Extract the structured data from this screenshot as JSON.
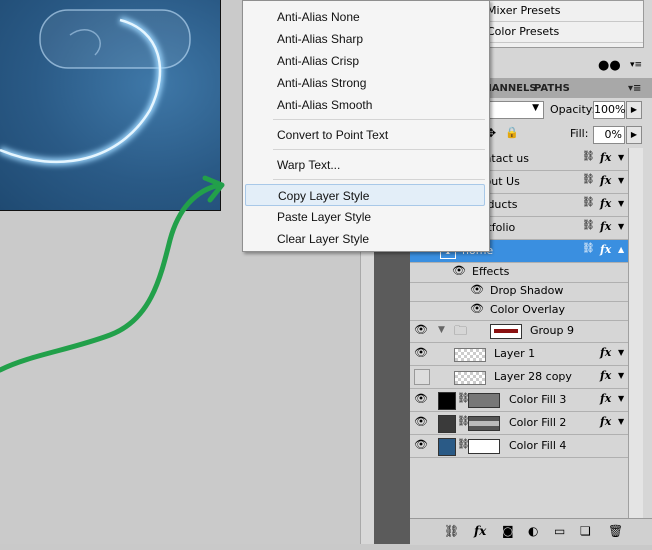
{
  "top_list": {
    "items": [
      "Mixer Presets",
      "Color Presets"
    ]
  },
  "layers_panel": {
    "tabs": [
      "CHANNELS",
      "PATHS"
    ],
    "opacity_label": "Opacity:",
    "opacity_value": "100%",
    "fill_label": "Fill:",
    "fill_value": "0%",
    "layers": [
      {
        "name": "Contact us",
        "fx": "fx"
      },
      {
        "name": "About Us",
        "fx": "fx"
      },
      {
        "name": "Products",
        "fx": "fx"
      },
      {
        "name": "Portfolio",
        "fx": "fx"
      },
      {
        "name": "home",
        "fx": "fx",
        "selected": true
      },
      {
        "name": "Effects"
      },
      {
        "name": "Drop Shadow"
      },
      {
        "name": "Color Overlay"
      },
      {
        "name": "Group 9"
      },
      {
        "name": "Layer 1",
        "fx": "fx"
      },
      {
        "name": "Layer 28 copy",
        "fx": "fx"
      },
      {
        "name": "Color Fill 3",
        "fx": "fx"
      },
      {
        "name": "Color Fill 2",
        "fx": "fx"
      },
      {
        "name": "Color Fill 4"
      }
    ],
    "colors": {
      "fill3": "#000000",
      "fill2": "#3a3a3a",
      "fill4": "#2a5a86",
      "selected": "#3a8fe0"
    }
  },
  "context_menu": {
    "items": [
      "Anti-Alias None",
      "Anti-Alias Sharp",
      "Anti-Alias Crisp",
      "Anti-Alias Strong",
      "Anti-Alias Smooth",
      "Convert to Point Text",
      "Warp Text...",
      "Copy Layer Style",
      "Paste Layer Style",
      "Clear Layer Style"
    ],
    "highlighted": "Copy Layer Style"
  },
  "icons": {
    "eye": "eye-icon",
    "link": "link-icon",
    "folder": "folder-icon",
    "lock": "lock-icon",
    "move": "move-icon"
  }
}
